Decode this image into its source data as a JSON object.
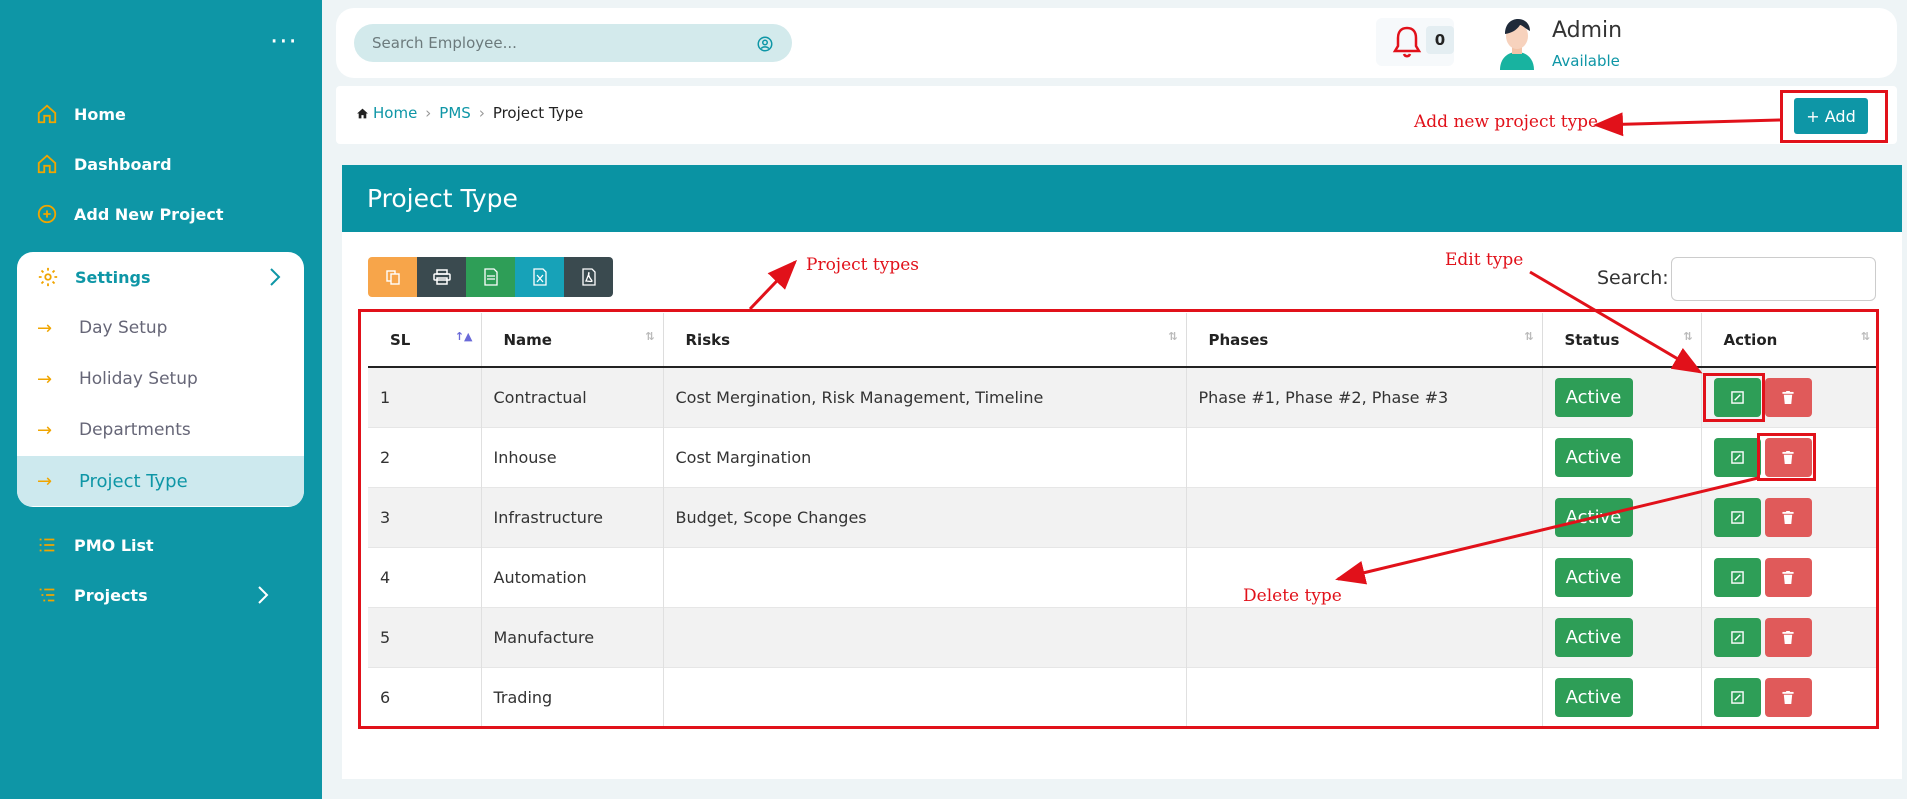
{
  "sidebar": {
    "menu_icon": "ellipsis-icon",
    "items": [
      {
        "label": "Home",
        "icon": "home-icon"
      },
      {
        "label": "Dashboard",
        "icon": "home-icon"
      },
      {
        "label": "Add New Project",
        "icon": "plus-circle-icon"
      }
    ],
    "settings": {
      "label": "Settings",
      "icon": "gear-icon",
      "children": [
        "Day Setup",
        "Holiday Setup",
        "Departments",
        "Project Type"
      ],
      "active": "Project Type"
    },
    "bottom_items": [
      {
        "label": "PMO List",
        "icon": "list-icon"
      },
      {
        "label": "Projects",
        "icon": "list-icon"
      }
    ]
  },
  "header": {
    "search_placeholder": "Search Employee...",
    "notification_count": "0",
    "user_name": "Admin",
    "user_status": "Available"
  },
  "breadcrumb": [
    "Home",
    "PMS",
    "Project Type"
  ],
  "add_button": "+ Add",
  "card_title": "Project Type",
  "table_search_label": "Search:",
  "toolbar": [
    "copy-icon",
    "print-icon",
    "csv-icon",
    "excel-icon",
    "pdf-icon"
  ],
  "columns": [
    "SL",
    "Name",
    "Risks",
    "Phases",
    "Status",
    "Action"
  ],
  "rows": [
    {
      "sl": "1",
      "name": "Contractual",
      "risks": "Cost Mergination, Risk Management, Timeline",
      "phases": "Phase #1, Phase #2, Phase #3",
      "status": "Active"
    },
    {
      "sl": "2",
      "name": "Inhouse",
      "risks": "Cost Margination",
      "phases": "",
      "status": "Active"
    },
    {
      "sl": "3",
      "name": "Infrastructure",
      "risks": "Budget, Scope Changes",
      "phases": "",
      "status": "Active"
    },
    {
      "sl": "4",
      "name": "Automation",
      "risks": "",
      "phases": "",
      "status": "Active"
    },
    {
      "sl": "5",
      "name": "Manufacture",
      "risks": "",
      "phases": "",
      "status": "Active"
    },
    {
      "sl": "6",
      "name": "Trading",
      "risks": "",
      "phases": "",
      "status": "Active"
    }
  ],
  "annotations": {
    "add": "Add new project type",
    "types": "Project types",
    "edit": "Edit type",
    "delete": "Delete type",
    "color": "#e1111a"
  },
  "colors": {
    "primary": "#0e96a6",
    "success": "#2e9e57",
    "danger": "#e05a5a",
    "accent": "#f0a500"
  }
}
